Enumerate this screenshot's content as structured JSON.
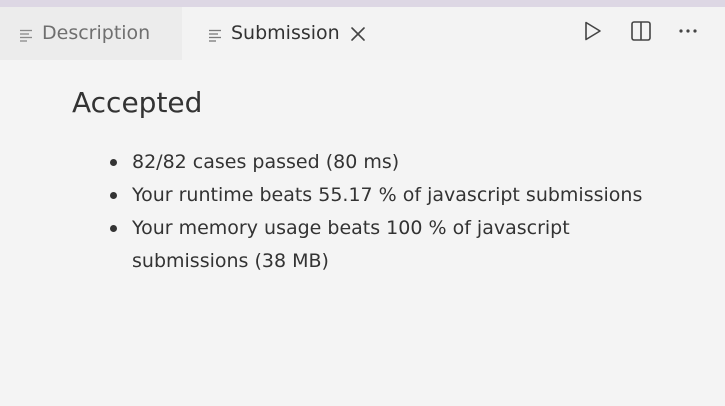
{
  "tabs": [
    {
      "label": "Description",
      "icon": "list-icon",
      "active": false
    },
    {
      "label": "Submission",
      "icon": "list-icon",
      "active": true,
      "close_icon": "close-icon"
    }
  ],
  "actions": [
    {
      "icon": "play-icon"
    },
    {
      "icon": "split-editor-icon"
    },
    {
      "icon": "more-icon"
    }
  ],
  "result": {
    "title": "Accepted",
    "items": [
      "82/82 cases passed (80 ms)",
      "Your runtime beats 55.17 % of javascript submissions",
      "Your memory usage beats 100 % of javascript submissions (38 MB)"
    ]
  },
  "colors": {
    "text": "#333333",
    "inactive_tab_text": "#6f6f6f",
    "top_strip": "#ddd7e4"
  }
}
